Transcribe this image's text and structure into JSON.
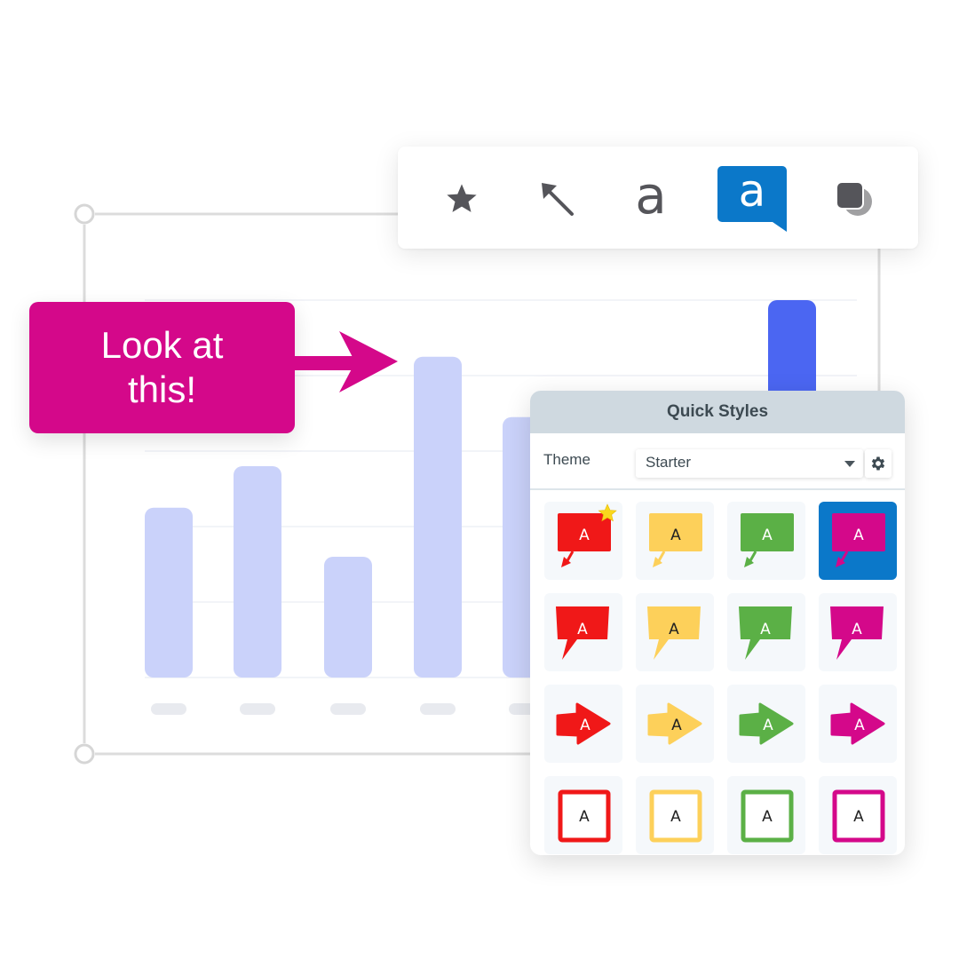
{
  "toolbar": {
    "tools": [
      {
        "name": "star-tool",
        "icon": "star-icon",
        "selected": false
      },
      {
        "name": "arrow-tool",
        "icon": "arrow-up-left-icon",
        "selected": false
      },
      {
        "name": "text-tool",
        "icon": "text-a-icon",
        "glyph": "a",
        "selected": false
      },
      {
        "name": "callout-tool",
        "icon": "callout-a-icon",
        "glyph": "a",
        "selected": true
      },
      {
        "name": "shape-tool",
        "icon": "shapes-icon",
        "selected": false
      }
    ],
    "colors": {
      "icon": "#55555a",
      "selected_bg": "#0b78c9",
      "selected_fg": "#ffffff"
    }
  },
  "callout": {
    "text": "Look at this!",
    "color": "#d4088a"
  },
  "chart_data": {
    "type": "bar",
    "categories": [
      "",
      "",
      "",
      "",
      "",
      ""
    ],
    "values": [
      2.25,
      2.8,
      1.6,
      4.25,
      3.45,
      5.0
    ],
    "highlighted_index": 5,
    "title": "",
    "xlabel": "",
    "ylabel": "",
    "ylim": [
      0,
      5
    ],
    "grid": true,
    "colors": {
      "bar": "#cad2fa",
      "highlight": "#4b66f2",
      "grid": "#eef0f6",
      "tick": "#e8eaef",
      "frame": "#dddddd"
    }
  },
  "quick_styles": {
    "title": "Quick Styles",
    "theme_label": "Theme",
    "theme_value": "Starter",
    "swatch_label": "A",
    "palette": [
      {
        "name": "red",
        "color": "#f01818",
        "text": "#ffffff"
      },
      {
        "name": "yellow",
        "color": "#fdd05a",
        "text": "#222222"
      },
      {
        "name": "green",
        "color": "#5bb046",
        "text": "#ffffff"
      },
      {
        "name": "magenta",
        "color": "#d4088a",
        "text": "#ffffff"
      }
    ],
    "rows": [
      {
        "style": "callout-arrow-tail",
        "label": "Callout with arrow"
      },
      {
        "style": "speech-bubble",
        "label": "Speech bubble"
      },
      {
        "style": "arrow-shape",
        "label": "Arrow"
      },
      {
        "style": "outlined-box",
        "label": "Outlined box"
      }
    ],
    "favorite": {
      "row": 0,
      "col": 0,
      "icon": "star-icon",
      "color": "#f9d81d"
    },
    "selected": {
      "row": 0,
      "col": 3
    }
  }
}
